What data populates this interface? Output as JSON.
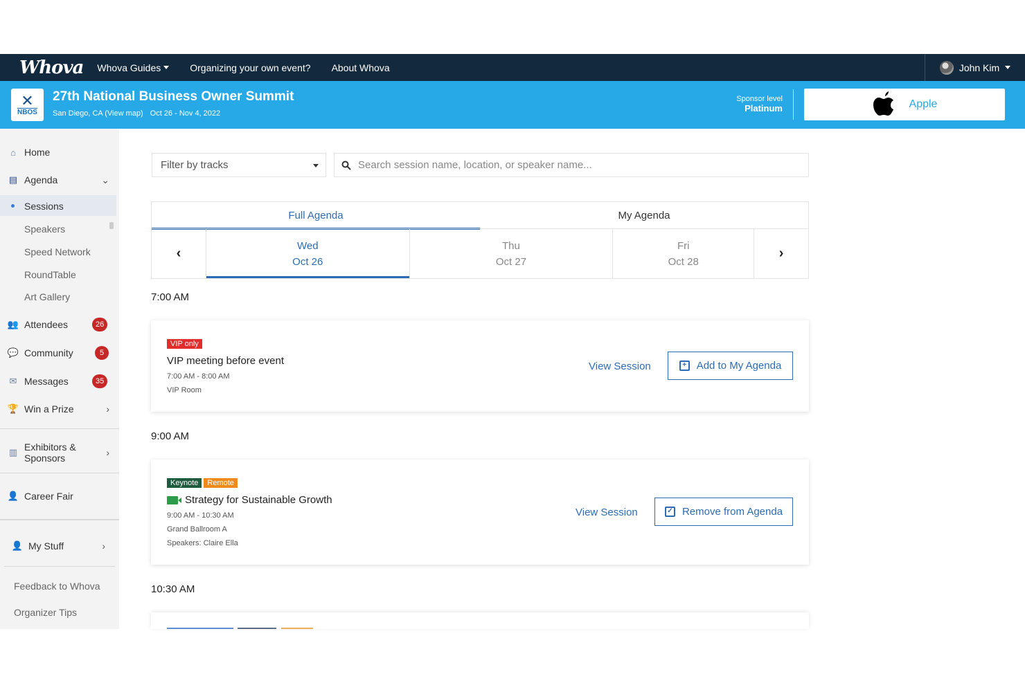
{
  "topnav": {
    "logo": "Whova",
    "links": [
      "Whova Guides",
      "Organizing your own event?",
      "About Whova"
    ],
    "user": "John Kim"
  },
  "event": {
    "logo_text": "NBOS",
    "title": "27th National Business Owner Summit",
    "location": "San Diego, CA (View map)",
    "dates": "Oct 26 - Nov 4, 2022",
    "sponsor_level_label": "Sponsor level",
    "sponsor_level": "Platinum",
    "sponsor_name": "Apple"
  },
  "sidebar": {
    "home": "Home",
    "agenda": "Agenda",
    "agenda_items": [
      "Sessions",
      "Speakers",
      "Speed Network",
      "RoundTable",
      "Art Gallery"
    ],
    "attendees": "Attendees",
    "attendees_count": "26",
    "community": "Community",
    "community_count": "5",
    "messages": "Messages",
    "messages_count": "35",
    "prize": "Win a Prize",
    "exhibitors": "Exhibitors & Sponsors",
    "career": "Career Fair",
    "mystuff": "My Stuff",
    "feedback": "Feedback to Whova",
    "tips": "Organizer Tips"
  },
  "filter": {
    "placeholder": "Filter by tracks"
  },
  "search": {
    "placeholder": "Search session name, location, or speaker name..."
  },
  "tabs": [
    "Full Agenda",
    "My Agenda"
  ],
  "days": [
    {
      "dow": "Wed",
      "date": "Oct 26"
    },
    {
      "dow": "Thu",
      "date": "Oct 27"
    },
    {
      "dow": "Fri",
      "date": "Oct 28"
    }
  ],
  "times": [
    "7:00 AM",
    "9:00 AM",
    "10:30 AM"
  ],
  "sessions": [
    {
      "tags": [
        "VIP only"
      ],
      "title": "VIP meeting before event",
      "time": "7:00 AM - 8:00 AM",
      "location": "VIP Room",
      "view": "View Session",
      "action": "Add to My Agenda"
    },
    {
      "tags": [
        "Keynote",
        "Remote"
      ],
      "title": "Strategy for Sustainable Growth",
      "time": "9:00 AM - 10:30 AM",
      "location": "Grand Ballroom A",
      "speakers": "Speakers: Claire Ella",
      "view": "View Session",
      "action": "Remove from Agenda"
    }
  ],
  "colors": {
    "nav": "#13293d",
    "event_bar": "#27a9e8",
    "accent": "#2d6cb5",
    "badge": "#c62828"
  }
}
